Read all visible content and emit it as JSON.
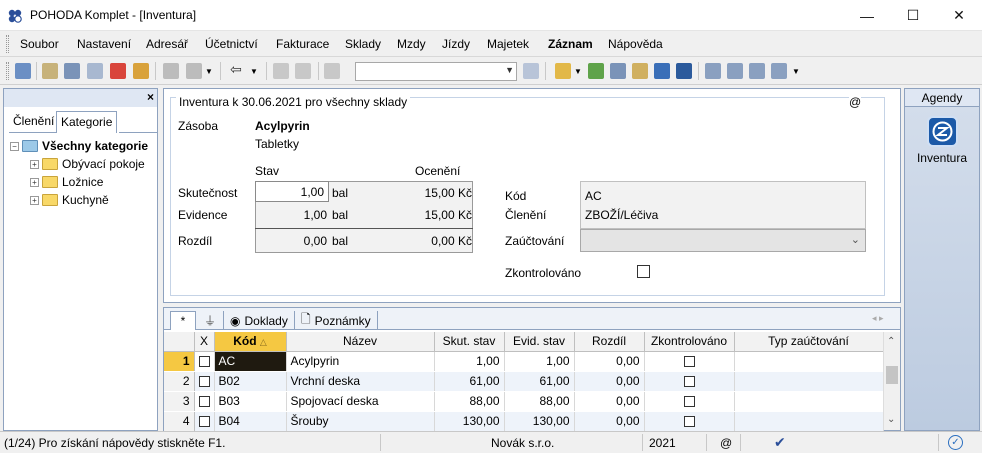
{
  "window": {
    "title": "POHODA Komplet - [Inventura]",
    "minimize": "—",
    "maximize": "☐",
    "close": "✕"
  },
  "menu": [
    "Soubor",
    "Nastavení",
    "Adresář",
    "Účetnictví",
    "Fakturace",
    "Sklady",
    "Mzdy",
    "Jízdy",
    "Majetek",
    "Záznam",
    "Nápověda"
  ],
  "left_panel": {
    "close": "×",
    "tabs": [
      "Členění",
      "Kategorie"
    ],
    "active_tab": "Kategorie",
    "tree_root": "Všechny kategorie",
    "tree_items": [
      "Obývací pokoje",
      "Ložnice",
      "Kuchyně"
    ]
  },
  "form": {
    "title": "Inventura k 30.06.2021 pro všechny sklady",
    "at": "@",
    "zasoba_label": "Zásoba",
    "zasoba_name": "Acylpyrin",
    "zasoba_desc": "Tabletky",
    "col_stav": "Stav",
    "col_oceneni": "Ocenění",
    "skutecnost_label": "Skutečnost",
    "skutecnost_value": "1,00",
    "skutecnost_unit": "bal",
    "skutecnost_price": "15,00 Kč",
    "evidence_label": "Evidence",
    "evidence_value": "1,00",
    "evidence_unit": "bal",
    "evidence_price": "15,00 Kč",
    "rozdil_label": "Rozdíl",
    "rozdil_value": "0,00",
    "rozdil_unit": "bal",
    "rozdil_price": "0,00 Kč",
    "kod_label": "Kód",
    "kod_value": "AC",
    "cleneni_label": "Členění",
    "cleneni_value": "ZBOŽÍ/Léčiva",
    "zauctovani_label": "Zaúčtování",
    "zkontrolovano_label": "Zkontrolováno"
  },
  "table": {
    "tabs": [
      "*",
      "Doklady",
      "Poznámky"
    ],
    "headers": [
      "X",
      "Kód",
      "Název",
      "Skut. stav",
      "Evid. stav",
      "Rozdíl",
      "Zkontrolováno",
      "Typ zaúčtování"
    ],
    "rows": [
      {
        "n": "1",
        "kod": "AC",
        "nazev": "Acylpyrin",
        "skut": "1,00",
        "evid": "1,00",
        "rozdil": "0,00"
      },
      {
        "n": "2",
        "kod": "B02",
        "nazev": "Vrchní deska",
        "skut": "61,00",
        "evid": "61,00",
        "rozdil": "0,00"
      },
      {
        "n": "3",
        "kod": "B03",
        "nazev": "Spojovací deska",
        "skut": "88,00",
        "evid": "88,00",
        "rozdil": "0,00"
      },
      {
        "n": "4",
        "kod": "B04",
        "nazev": "Šrouby",
        "skut": "130,00",
        "evid": "130,00",
        "rozdil": "0,00"
      }
    ]
  },
  "agendy": {
    "title": "Agendy",
    "item": "Inventura"
  },
  "statusbar": {
    "hint": "(1/24) Pro získání nápovědy stiskněte F1.",
    "company": "Novák s.r.o.",
    "year": "2021",
    "at": "@"
  },
  "colors": {
    "accent": "#1c5aa8",
    "selected_row": "#f5c842",
    "panel_border": "#8ea2bf"
  }
}
